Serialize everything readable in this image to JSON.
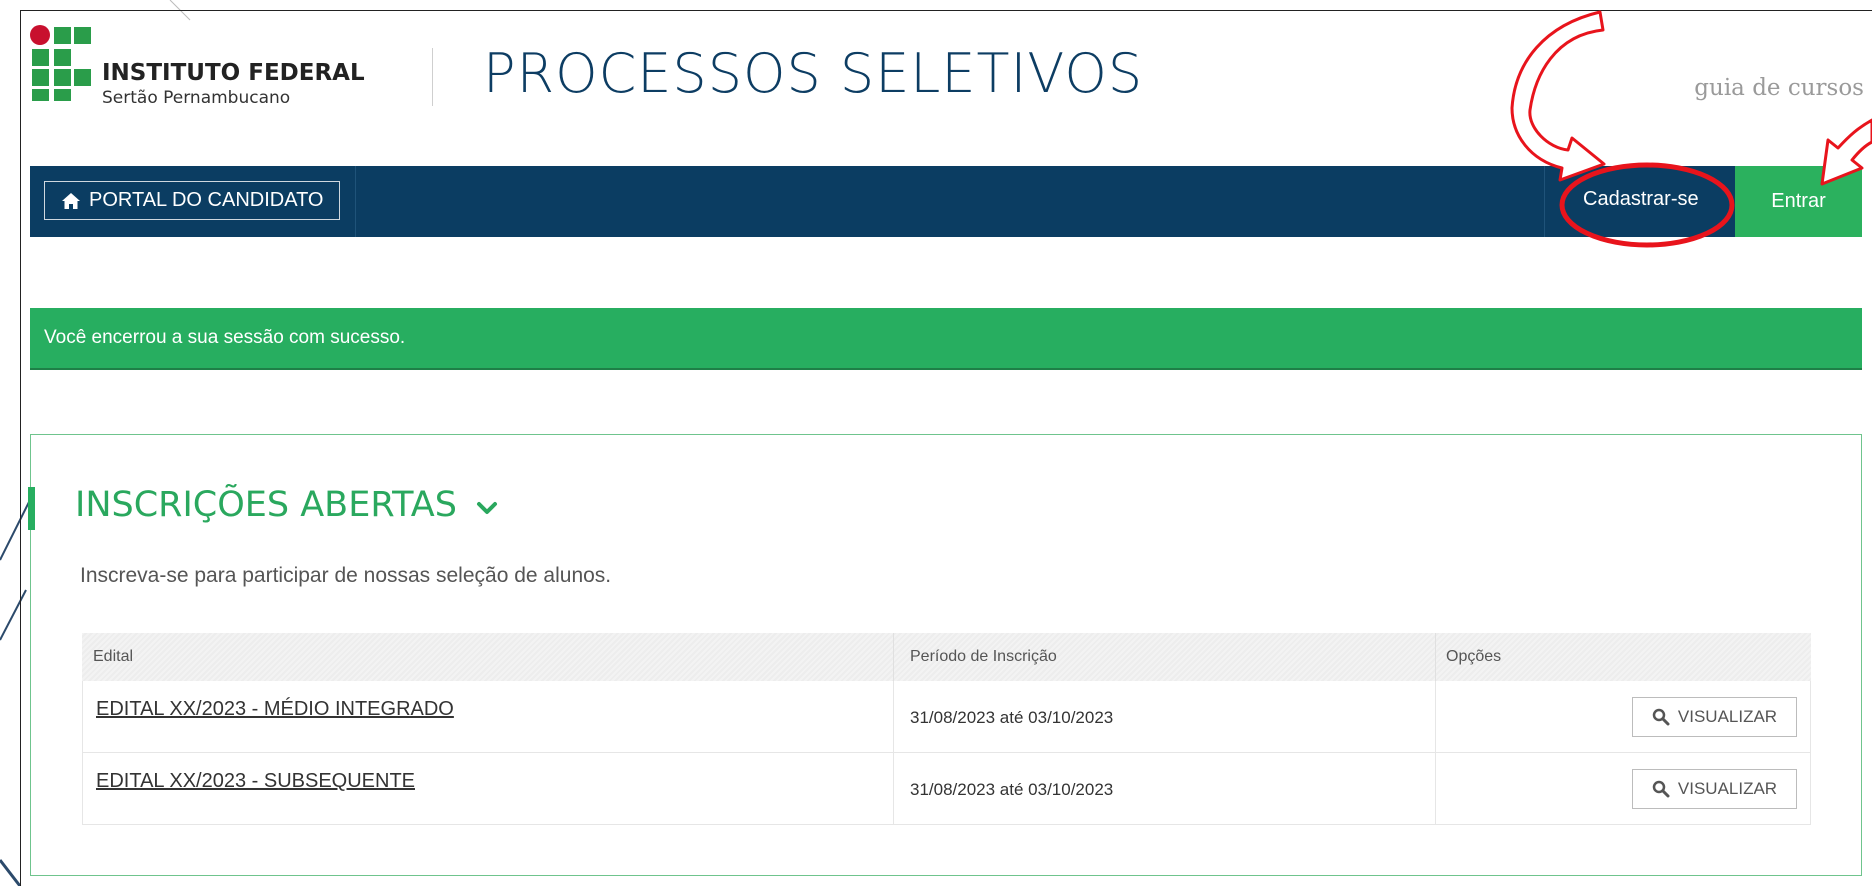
{
  "logo": {
    "title": "INSTITUTO FEDERAL",
    "subtitle": "Sertão Pernambucano",
    "colors": {
      "green": "#2a9d4a",
      "red": "#c8102e"
    }
  },
  "header": {
    "site_title": "PROCESSOS SELETIVOS",
    "guide_link": "guia de cursos"
  },
  "navbar": {
    "portal_label": "PORTAL DO CANDIDATO",
    "portal_icon": "home-icon",
    "register_label": "Cadastrar-se",
    "login_label": "Entrar",
    "background_color": "#0b3d62",
    "login_color": "#2bb15e"
  },
  "alert": {
    "message": "Você encerrou a sua sessão com sucesso.",
    "color": "#27ae60"
  },
  "section": {
    "title": "INSCRIÇÕES ABERTAS",
    "chevron_icon": "chevron-down-icon",
    "description": "Inscreva-se para participar de nossas seleção de alunos."
  },
  "table": {
    "headers": {
      "edital": "Edital",
      "periodo": "Período de Inscrição",
      "opcoes": "Opções"
    },
    "rows": [
      {
        "edital": "EDITAL XX/2023 - MÉDIO INTEGRADO",
        "periodo": "31/08/2023 até 03/10/2023",
        "action_label": "VISUALIZAR",
        "action_icon": "search-icon"
      },
      {
        "edital": "EDITAL XX/2023 - SUBSEQUENTE",
        "periodo": "31/08/2023 até 03/10/2023",
        "action_label": "VISUALIZAR",
        "action_icon": "search-icon"
      }
    ]
  },
  "annotations": {
    "color": "#e8141c",
    "marks": [
      "curved-arrow-to-register",
      "circle-around-register",
      "arrow-to-login"
    ]
  }
}
